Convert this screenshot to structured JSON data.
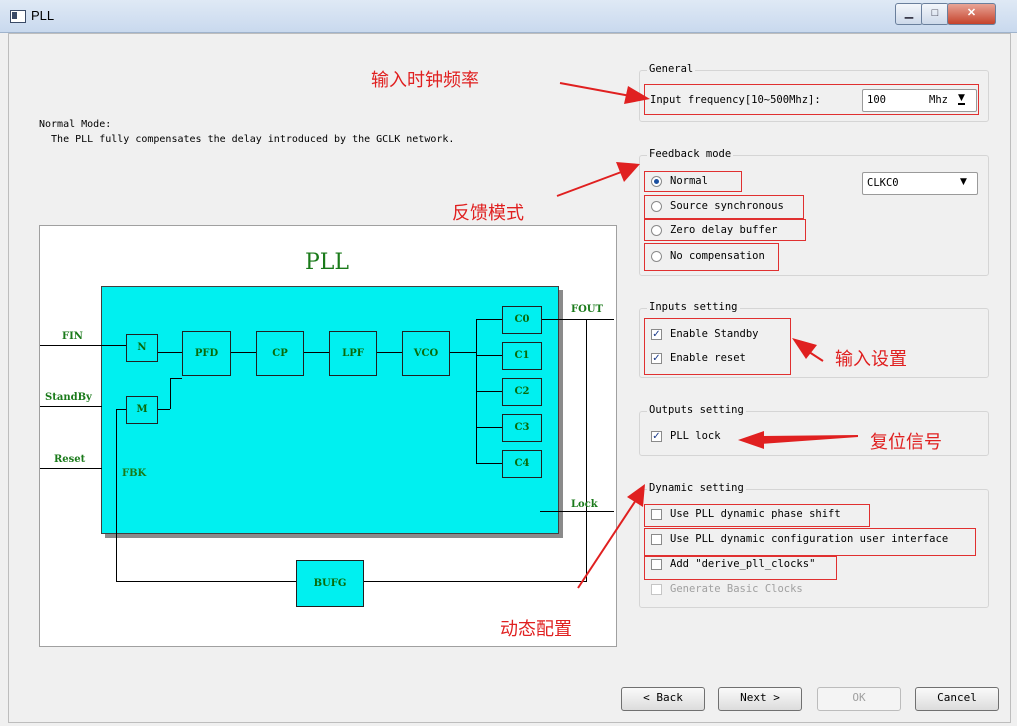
{
  "window": {
    "title": "PLL"
  },
  "description": {
    "heading": "Normal Mode:",
    "text": "  The PLL fully compensates the delay introduced by the GCLK network."
  },
  "diagram": {
    "title": "PLL",
    "pins": {
      "fin": "FIN",
      "standby": "StandBy",
      "reset": "Reset",
      "fbk": "FBK",
      "fout": "FOUT",
      "lock": "Lock"
    },
    "blocks": {
      "n": "N",
      "m": "M",
      "pfd": "PFD",
      "cp": "CP",
      "lpf": "LPF",
      "vco": "VCO",
      "c0": "C0",
      "c1": "C1",
      "c2": "C2",
      "c3": "C3",
      "c4": "C4",
      "bufg": "BUFG"
    }
  },
  "general": {
    "title": "General",
    "freq_label": "Input frequency[10~500Mhz]:",
    "freq_value": "100",
    "freq_unit": "Mhz"
  },
  "feedback": {
    "title": "Feedback mode",
    "options": [
      "Normal",
      "Source synchronous",
      "Zero delay buffer",
      "No compensation"
    ],
    "selected": "Normal",
    "clock_select": "CLKC0"
  },
  "inputs": {
    "title": "Inputs setting",
    "enable_standby": "Enable Standby",
    "enable_reset": "Enable reset"
  },
  "outputs": {
    "title": "Outputs setting",
    "pll_lock": "PLL lock"
  },
  "dynamic": {
    "title": "Dynamic setting",
    "phase_shift": "Use PLL dynamic phase shift",
    "config_ui": "Use PLL dynamic configuration user interface",
    "derive": "Add \"derive_pll_clocks\"",
    "generate": "Generate Basic Clocks"
  },
  "annotations": {
    "input_freq": "输入时钟频率",
    "feedback": "反馈模式",
    "inputs": "输入设置",
    "reset_signal": "复位信号",
    "dynamic": "动态配置"
  },
  "buttons": {
    "back": "< Back",
    "next": "Next >",
    "ok": "OK",
    "cancel": "Cancel"
  },
  "colors": {
    "block_fill": "#00f0f0",
    "pin_text": "#1a7a1a",
    "annotation": "#e02020"
  }
}
